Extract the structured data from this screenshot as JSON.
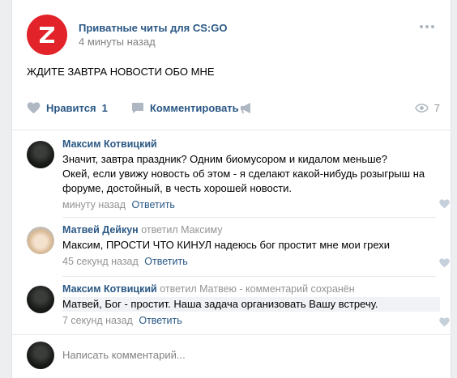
{
  "post": {
    "group_name": "Приватные читы для CS:GO",
    "time": "4 минуты назад",
    "logo_letter": "Z",
    "text": "ЖДИТЕ ЗАВТРА НОВОСТИ ОБО МНЕ",
    "accent_color": "#e2232a"
  },
  "actions": {
    "like_label": "Нравится",
    "like_count": "1",
    "comment_label": "Комментировать",
    "views": "7"
  },
  "comments": [
    {
      "author": "Максим Котвицкий",
      "reply_to": "",
      "text_lines": [
        "Значит, завтра праздник? Одним биомусором и кидалом меньше?",
        "Окей, если увижу новость об этом - я сделают какой-нибудь розыгрыш на",
        "форуме, достойный, в честь хорошей новости."
      ],
      "time": "минуту назад",
      "reply_label": "Ответить"
    },
    {
      "author": "Матвей Дейкун",
      "reply_to": "ответил Максиму",
      "text_lines": [
        "Максим, ПРОСТИ ЧТО КИНУЛ надеюсь бог простит мне мои грехи"
      ],
      "time": "45 секунд назад",
      "reply_label": "Ответить"
    },
    {
      "author": "Максим Котвицкий",
      "reply_to": "ответил Матвею - комментарий сохранён",
      "text_lines": [
        "Матвей, Бог - простит. Наша задача организовать Вашу встречу."
      ],
      "time": "7 секунд назад",
      "reply_label": "Ответить"
    }
  ],
  "write": {
    "placeholder": "Написать комментарий..."
  }
}
